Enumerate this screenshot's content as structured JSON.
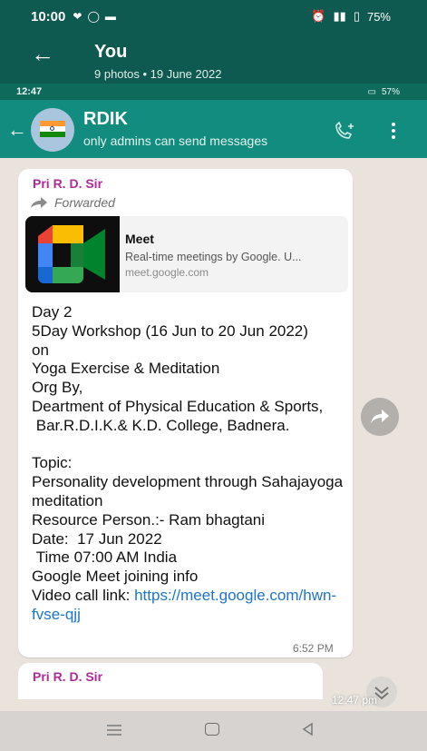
{
  "outer": {
    "status_time": "10:00",
    "battery": "75%",
    "title": "You",
    "subtitle": "9 photos  •  19 June 2022"
  },
  "inner": {
    "status_time": "12:47",
    "status_right": "57%",
    "group_name": "RDIK",
    "group_sub": "only admins can send messages"
  },
  "message": {
    "sender": "Pri R. D. Sir",
    "forwarded_label": "Forwarded",
    "link_card": {
      "title": "Meet",
      "description": "Real-time meetings by Google. U...",
      "url": "meet.google.com"
    },
    "body": "Day 2\n5Day Workshop (16 Jun to 20 Jun 2022)\non\nYoga Exercise & Meditation\nOrg By,\nDeartment of Physical Education & Sports,\n Bar.R.D.I.K.& K.D. College, Badnera.\n\nTopic:\nPersonality development through Sahajayoga meditation\nResource Person.:- Ram bhagtani\nDate:  17 Jun 2022\n Time 07:00 AM India\nGoogle Meet joining info\nVideo call link: ",
    "link": "https://meet.google.com/hwn-fvse-qjj",
    "time": "6:52 PM"
  },
  "next_message": {
    "sender": "Pri R. D. Sir"
  },
  "overlay_time": "12:47 pm",
  "colors": {
    "header_dark": "#0f5a50",
    "header": "#118c7e",
    "sender": "#b02a9a",
    "link": "#1e74c9"
  }
}
